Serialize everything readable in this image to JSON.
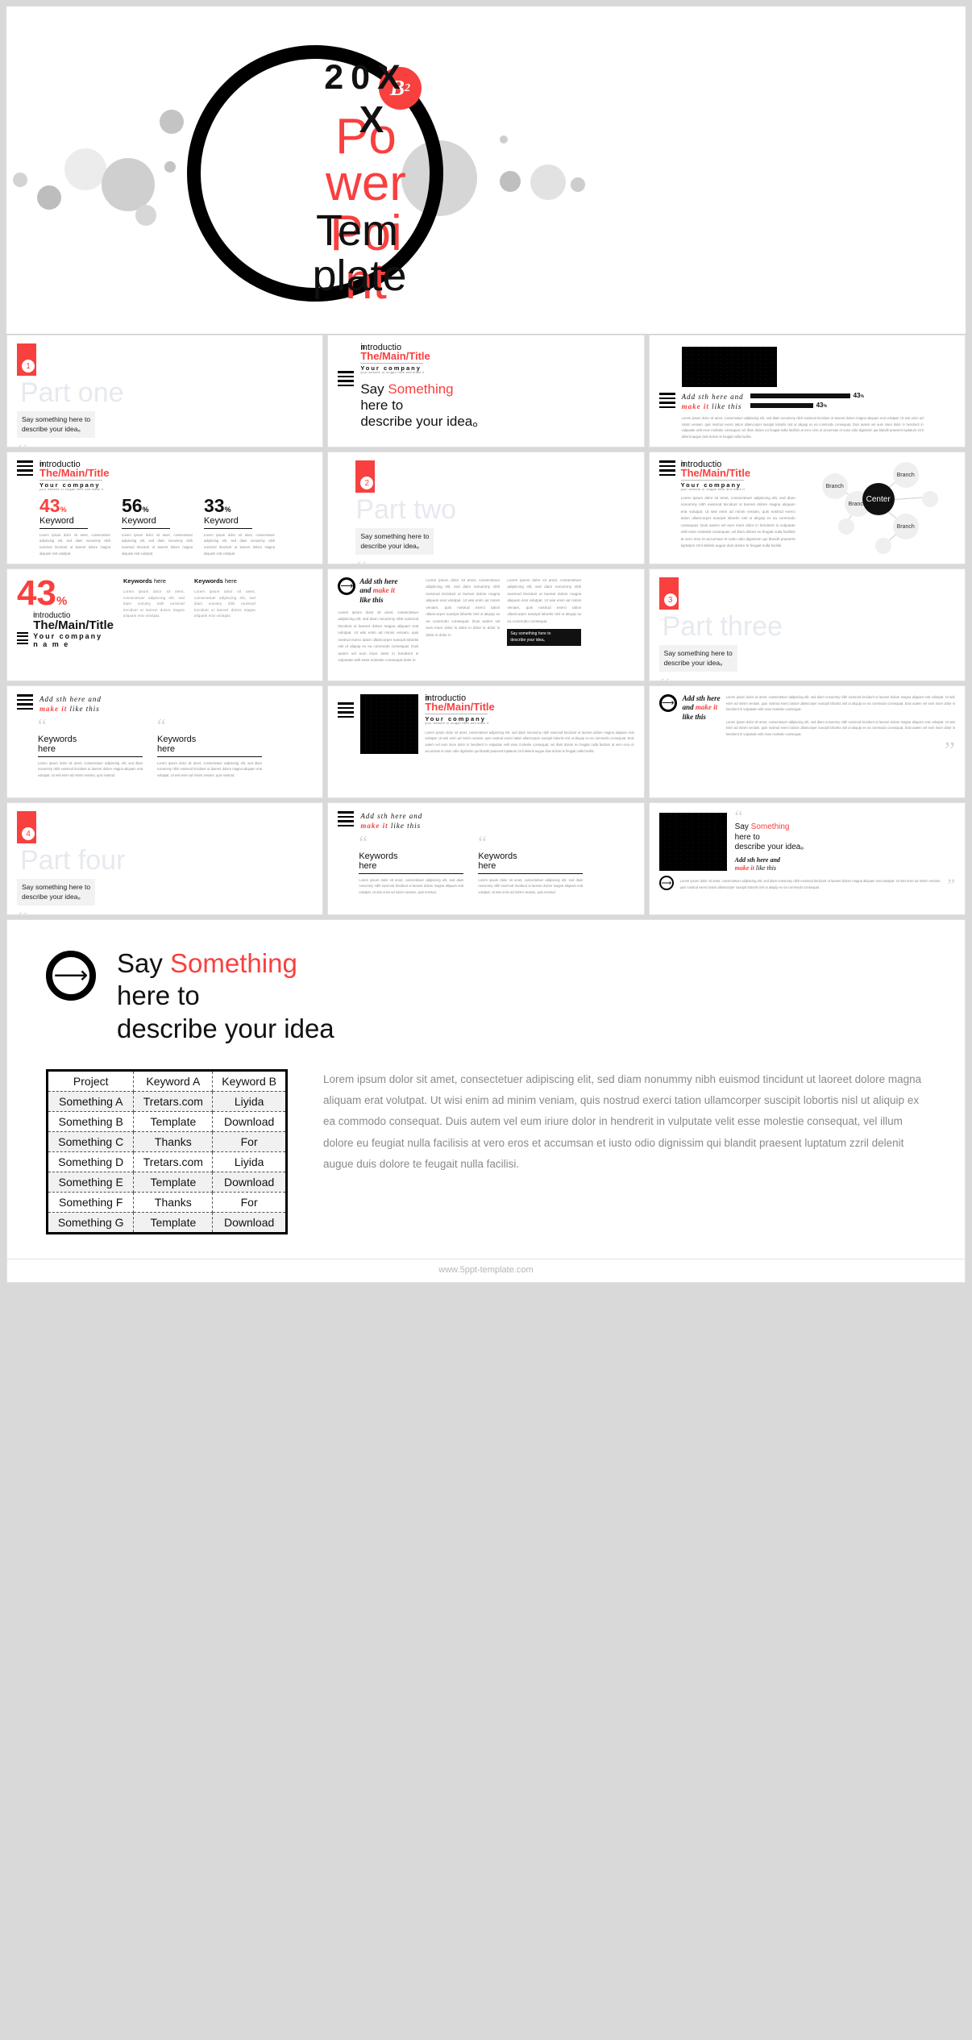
{
  "hero": {
    "year": "20X",
    "badge_letter": "B",
    "badge_sup": "2",
    "word_red_1": "Po",
    "word_red_2": "wer",
    "word_red_3": "Poi",
    "word_red_4": "nt",
    "word_black_x": "X",
    "word_black_1": "Tem",
    "word_black_2": "plate"
  },
  "slides": [
    {
      "id": "part-one",
      "kind": "section",
      "number": "1",
      "part_title": "Part one",
      "say": "Say something here to\ndescribe your idea。",
      "quote": "“"
    },
    {
      "id": "intro-say-something",
      "kind": "intro-big",
      "intro_small": "introductio",
      "intro_small_2": "n",
      "title": "The/Main/Title",
      "company": "Your  company",
      "slogan": "your website or slogan here and make it",
      "big_1": "Say ",
      "big_red": "Something",
      "big_2": "here to",
      "big_3": "describe your idea。"
    },
    {
      "id": "photo-bars",
      "kind": "photo-bars",
      "head_line1": "Add sth here and",
      "head_line2_red": "make it",
      "head_line2": " like this",
      "bars": [
        {
          "value": "43",
          "unit": "%",
          "pct": 100
        },
        {
          "value": "43",
          "unit": "%",
          "pct": 62
        }
      ],
      "lorem": "Lorem ipsum dolor sit amet, consectetuer adipiscing elit, sed diam nonummy nibh euismod tincidunt ut laoreet dolore magna aliquam erat volutpat. Ut wisi enim ad minim veniam, quis nostrud exerci tation ullamcorper suscipit lobortis nisl ut aliquip ex ea commodo consequat. Duis autem vel eum iriure dolor in hendrerit in vulputate velit esse molestie consequat, vel illum dolore eu feugiat nulla facilisis at vero eros et accumsan et iusto odio dignissim qui blandit praesent luptatum zzril delenit augue duis dolore te feugait nulla facilisi."
    },
    {
      "id": "three-keywords",
      "kind": "stats",
      "intro_small": "introductio",
      "intro_small_2": "n",
      "title": "The/Main/Title",
      "company": "Your  company",
      "slogan": "your website or slogan here and make it",
      "stats": [
        {
          "value": "43",
          "unit": "%",
          "label": "Keyword",
          "red": true,
          "lorem": "Lorem ipsum dolor sit amet, consectetuer adipiscing elit, sed diam nonummy nibh euismod tincidunt ut laoreet dolore magna aliquam erat volutpat."
        },
        {
          "value": "56",
          "unit": "%",
          "label": "Keyword",
          "red": false,
          "lorem": "Lorem ipsum dolor sit amet, consectetuer adipiscing elit, sed diam nonummy nibh euismod tincidunt ut laoreet dolore magna aliquam erat volutpat."
        },
        {
          "value": "33",
          "unit": "%",
          "label": "Keyword",
          "red": false,
          "lorem": "Lorem ipsum dolor sit amet, consectetuer adipiscing elit, sed diam nonummy nibh euismod tincidunt ut laoreet dolore magna aliquam erat volutpat."
        }
      ]
    },
    {
      "id": "part-two",
      "kind": "section",
      "number": "2",
      "part_title": "Part two",
      "say": "Say something here to\ndescribe your idea。",
      "quote": "“"
    },
    {
      "id": "branch-diagram",
      "kind": "diagram",
      "intro_small": "introductio",
      "intro_small_2": "n",
      "title": "The/Main/Title",
      "company": "Your  company",
      "slogan": "your website or slogan here and make it",
      "lorem": "Lorem ipsum dolor sit amet, consectetuer adipiscing elit, sed diam nonummy nibh euismod tincidunt ut laoreet dolore magna aliquam erat volutpat. Ut wisi enim ad minim veniam, quis nostrud exerci tation ullamcorper suscipit lobortis nisl ut aliquip ex ea commodo consequat. Duis autem vel eum iriure dolor in hendrerit in vulputate velit esse molestie consequat, vel illum dolore eu feugiat nulla facilisis at vero eros et accumsan et iusto odio dignissim qui blandit praesent luptatum zzril delenit augue duis dolore te feugait nulla facilisi.",
      "center": "Center",
      "branches": [
        "Branch",
        "Branch",
        "Branch",
        "Branch"
      ]
    },
    {
      "id": "big-43-keywords",
      "kind": "big43",
      "value": "43",
      "unit": "%",
      "intro_small": "introductio",
      "intro_small_2": "n",
      "title": "The/Main/Title",
      "company": "Your  company",
      "company2": "n      a      m      e",
      "cards": [
        {
          "kw_bold": "Keywords",
          "kw_rest": " here",
          "lorem": "Lorem ipsum dolor sit amet, consectetuer adipiscing elit, sed diam nonumy nibh euismod tincidunt ut laoreet dolore magna aliquam erat volutpat."
        },
        {
          "kw_bold": "Keywords",
          "kw_rest": " here",
          "lorem": "Lorem ipsum dolor sit amet, consectetuer adipiscing elit, sed diam nonumy nibh euismod tincidunt ut laoreet dolore magna aliquam erat volutpat."
        }
      ]
    },
    {
      "id": "add-sth-three-col",
      "kind": "threecol",
      "head_1": "Add sth here",
      "head_2": "and ",
      "head_red": "make it",
      "head_3": "like this",
      "col1": "Lorem ipsum dolor sit amet, consectetuer adipiscing elit, sed diam nonummy nibh euismod tincidunt ut laoreet dolore magna aliquam erat volutpat. Ut wisi enim ad minim veniam, quis nostrud exerci tation ullamcorper suscipit lobortis nisl ut aliquip ex ea commodo consequat. Duis autem vel eum iriure dolor in hendrerit in vulputate velit esse molestie consequat dolor in",
      "col2": "Lorem ipsum dolor sit amet, consectetuer adipiscing elit, sed diam nonummy nibh euismod tincidunt ut laoreet dolore magna aliquam erat volutpat. Ut wisi enim ad minim veniam, quis nostrud exerci tation ullamcorper suscipit lobortis nisl ut aliquip ex ea commodo consequat. Duis autem vel eum iriure dolor in dolor in dolor in dolor in dolor in dolor in",
      "col3": "Lorem ipsum dolor sit amet, consectetuer adipiscing elit, sed diam nonummy nibh euismod tincidunt ut laoreet dolore magna aliquam erat volutpat. Ut wisi enim ad minim veniam, quis nostrud exerci tation ullamcorper suscipit lobortis nisl ut aliquip ex ea commodo consequat.",
      "cta": "Say something here to\ndescribe your idea。"
    },
    {
      "id": "part-three",
      "kind": "section",
      "number": "3",
      "part_title": "Part three",
      "say": "Say something here to\ndescribe your idea。",
      "quote": "“"
    },
    {
      "id": "two-keywords-quotes",
      "kind": "twoquote",
      "head_line1": "Add sth here and",
      "head_line2_red": "make it",
      "head_line2": " like this",
      "cards": [
        {
          "kw1": "Keywords",
          "kw2": "here",
          "lorem": "Lorem ipsum dolor sit amet, consectetuer adipiscing elit, sed diam nonummy nibh euismod tincidunt ut laoreet dolore magna aliquam erat volutpat. Ut wisi enim ad minim veniam, quis nostrud."
        },
        {
          "kw1": "Keywords",
          "kw2": "here",
          "lorem": "Lorem ipsum dolor sit amet, consectetuer adipiscing elit, sed diam nonummy nibh euismod tincidunt ut laoreet dolore magna aliquam erat volutpat. Ut wisi enim ad minim veniam, quis nostrud."
        }
      ]
    },
    {
      "id": "photo-intro",
      "kind": "photointro",
      "intro_small": "introductio",
      "intro_small_2": "n",
      "title": "The/Main/Title",
      "company": "Your  company",
      "slogan": "your website or slogan here and make it",
      "lorem": "Lorem ipsum dolor sit amet, consectetuer adipiscing elit, sed diam nonummy nibh euismod tincidunt ut laoreet dolore magna aliquam erat volutpat. Ut wisi enim ad minim veniam, quis nostrud exerci tation ullamcorper suscipit lobortis nisl ut aliquip ex ea commodo consequat. Duis autem vel eum iriure dolor in hendrerit in vulputate velit esse molestie consequat, vel illum dolore eu feugiat nulla facilisis at vero eros et accumsan et iusto odio dignissim qui blandit praesent luptatum zzril delenit augue duis dolore te feugait nulla facilisi."
    },
    {
      "id": "add-sth-wide",
      "kind": "wide",
      "head_1": "Add sth here",
      "head_2": "and ",
      "head_red": "make it",
      "head_3": "like this",
      "para1": "Lorem ipsum dolor sit amet, consectetuer adipiscing elit, sed diam nonummy nibh euismod tincidunt ut laoreet dolore magna aliquam erat volutpat. Ut wisi enim ad minim veniam, quis nostrud exerci tation ullamcorper suscipit lobortis nisl ut aliquip ex ea commodo consequat. Duis autem vel eum iriure dolor in hendrerit in vulputate velit esse molestie consequat.",
      "para2": "Lorem ipsum dolor sit amet, consectetuer adipiscing elit, sed diam nonummy nibh euismod tincidunt ut laoreet dolore magna aliquam erat volutpat. Ut wisi enim ad minim veniam, quis nostrud exerci tation ullamcorper suscipit lobortis nisl ut aliquip ex ea commodo consequat. Duis autem vel eum iriure dolor in hendrerit in vulputate velit esse molestie consequat.",
      "quote": "”"
    },
    {
      "id": "part-four",
      "kind": "section",
      "number": "4",
      "part_title": "Part four",
      "say": "Say something here to\ndescribe your idea。",
      "quote": "“"
    },
    {
      "id": "two-keywords-b",
      "kind": "twoquote",
      "head_line1": "Add sth here and",
      "head_line2_red": "make it",
      "head_line2": " like this",
      "cards": [
        {
          "kw1": "Keywords",
          "kw2": "here",
          "lorem": "Lorem ipsum dolor sit amet, consectetuer adipiscing elit, sed diam nonummy nibh euismod tincidunt ut laoreet dolore magna aliquam erat volutpat. Ut wisi enim ad minim veniam, quis nostrud."
        },
        {
          "kw1": "Keywords",
          "kw2": "here",
          "lorem": "Lorem ipsum dolor sit amet, consectetuer adipiscing elit, sed diam nonummy nibh euismod tincidunt ut laoreet dolore magna aliquam erat volutpat. Ut wisi enim ad minim veniam, quis nostrud."
        }
      ]
    },
    {
      "id": "photo-say-something",
      "kind": "photosay",
      "big_1": "Say ",
      "big_red": "Something",
      "big_2": "here to",
      "big_3": "describe your idea。",
      "sub_1": "Add sth here and",
      "sub_red": "make it",
      "sub_2": " like this",
      "lorem": "Lorem ipsum dolor sit amet, consectetuer adipiscing elit, sed diam nonummy nibh euismod tincidunt ut laoreet dolore magna aliquam erat volutpat. Ut wisi enim ad minim veniam, quis nostrud exerci tation ullamcorper suscipit lobortis nisl ut aliquip ex ea commodo consequat.",
      "quote_open": "“",
      "quote_close": "”"
    }
  ],
  "bottom": {
    "title_1": "Say ",
    "title_red": "Something",
    "title_2": "here to",
    "title_3": "describe your idea",
    "arrow_icon": "→",
    "table": {
      "headers": [
        "Project",
        "Keyword A",
        "Keyword B"
      ],
      "rows": [
        [
          "Something A",
          "Tretars.com",
          "Liyida"
        ],
        [
          "Something B",
          "Template",
          "Download"
        ],
        [
          "Something C",
          "Thanks",
          "For"
        ],
        [
          "Something D",
          "Tretars.com",
          "Liyida"
        ],
        [
          "Something E",
          "Template",
          "Download"
        ],
        [
          "Something F",
          "Thanks",
          "For"
        ],
        [
          "Something G",
          "Template",
          "Download"
        ]
      ]
    },
    "paragraph": "Lorem ipsum dolor sit amet, consectetuer adipiscing elit, sed diam nonummy nibh euismod tincidunt ut laoreet dolore magna aliquam erat volutpat. Ut wisi enim ad minim veniam, quis nostrud exerci tation ullamcorper suscipit lobortis nisl ut aliquip ex ea commodo consequat. Duis autem vel eum iriure dolor in hendrerit in vulputate velit esse molestie consequat, vel illum dolore eu feugiat nulla facilisis at vero eros et accumsan et iusto odio dignissim qui blandit praesent luptatum zzril delenit augue duis dolore te feugait nulla facilisi."
  },
  "footer": {
    "url": "www.5ppt-template.com"
  },
  "colors": {
    "accent": "#f8403f",
    "ink": "#111111",
    "muted": "#8d8d8d",
    "ghost": "#e6e9ee"
  }
}
